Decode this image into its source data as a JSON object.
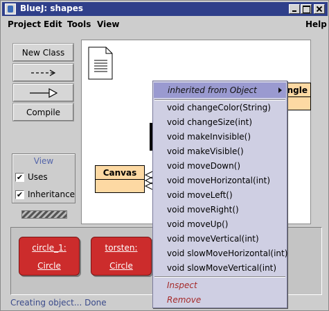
{
  "window": {
    "title": "BlueJ:  shapes"
  },
  "menubar": {
    "items": [
      "Project",
      "Edit",
      "Tools",
      "View"
    ],
    "help": "Help"
  },
  "tools": {
    "new_class": "New Class",
    "dependency_arrow": "--->",
    "inheritance_arrow": "triangle-arrow",
    "compile": "Compile"
  },
  "view": {
    "title": "View",
    "uses_label": "Uses",
    "uses_checked": true,
    "inheritance_label": "Inheritance",
    "inheritance_checked": true
  },
  "diagram": {
    "classes": [
      {
        "name": "Canvas"
      },
      {
        "name": "ngle"
      }
    ]
  },
  "objects": [
    {
      "name": "circle_1:",
      "type": "Circle"
    },
    {
      "name": "torsten:",
      "type": "Circle"
    }
  ],
  "status": "Creating object... Done",
  "popup": {
    "header": "inherited from Object",
    "methods": [
      "void changeColor(String)",
      "void changeSize(int)",
      "void makeInvisible()",
      "void makeVisible()",
      "void moveDown()",
      "void moveHorizontal(int)",
      "void moveLeft()",
      "void moveRight()",
      "void moveUp()",
      "void moveVertical(int)",
      "void slowMoveHorizontal(int)",
      "void slowMoveVertical(int)"
    ],
    "actions": [
      "Inspect",
      "Remove"
    ]
  },
  "colors": {
    "titlebar": "#2f3f8a",
    "class_fill": "#fdd9a3",
    "object_fill": "#cc2c2c",
    "popup_bg": "#cfcfe3",
    "popup_header": "#9a9ad0"
  }
}
